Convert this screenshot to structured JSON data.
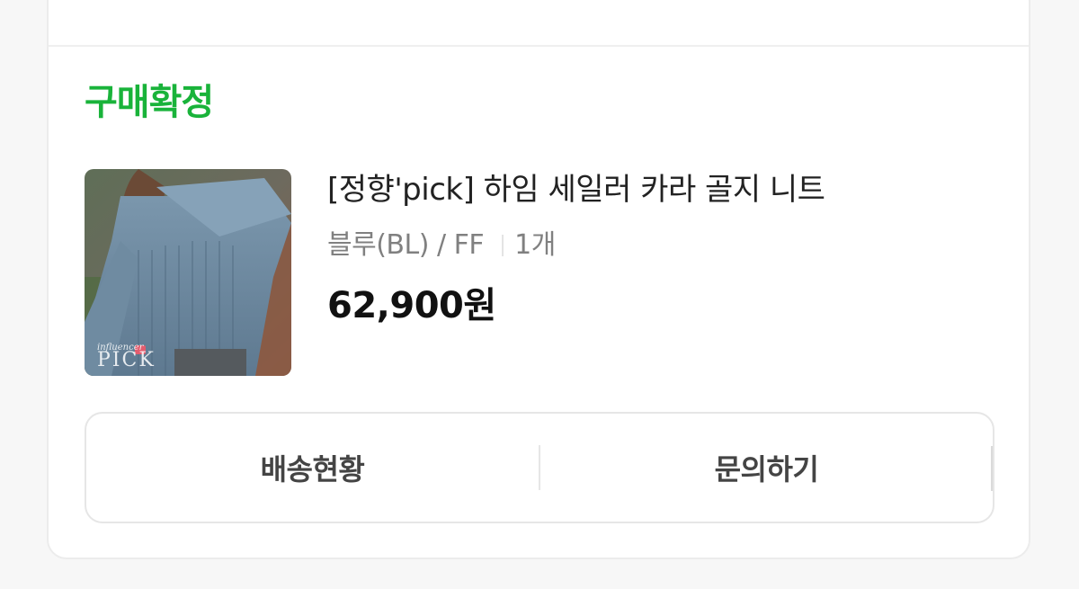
{
  "order": {
    "status": "구매확정",
    "status_color": "#19b33a",
    "product_name": "[정향'pick] 하임 세일러 카라 골지 니트",
    "option": "블루(BL) / FF",
    "quantity": "1개",
    "price": "62,900원",
    "thumbnail": {
      "description_icon": "product-photo",
      "badge_small": "influencer",
      "badge_big": "PICK"
    }
  },
  "actions": {
    "shipping_status": "배송현황",
    "inquiry": "문의하기"
  }
}
